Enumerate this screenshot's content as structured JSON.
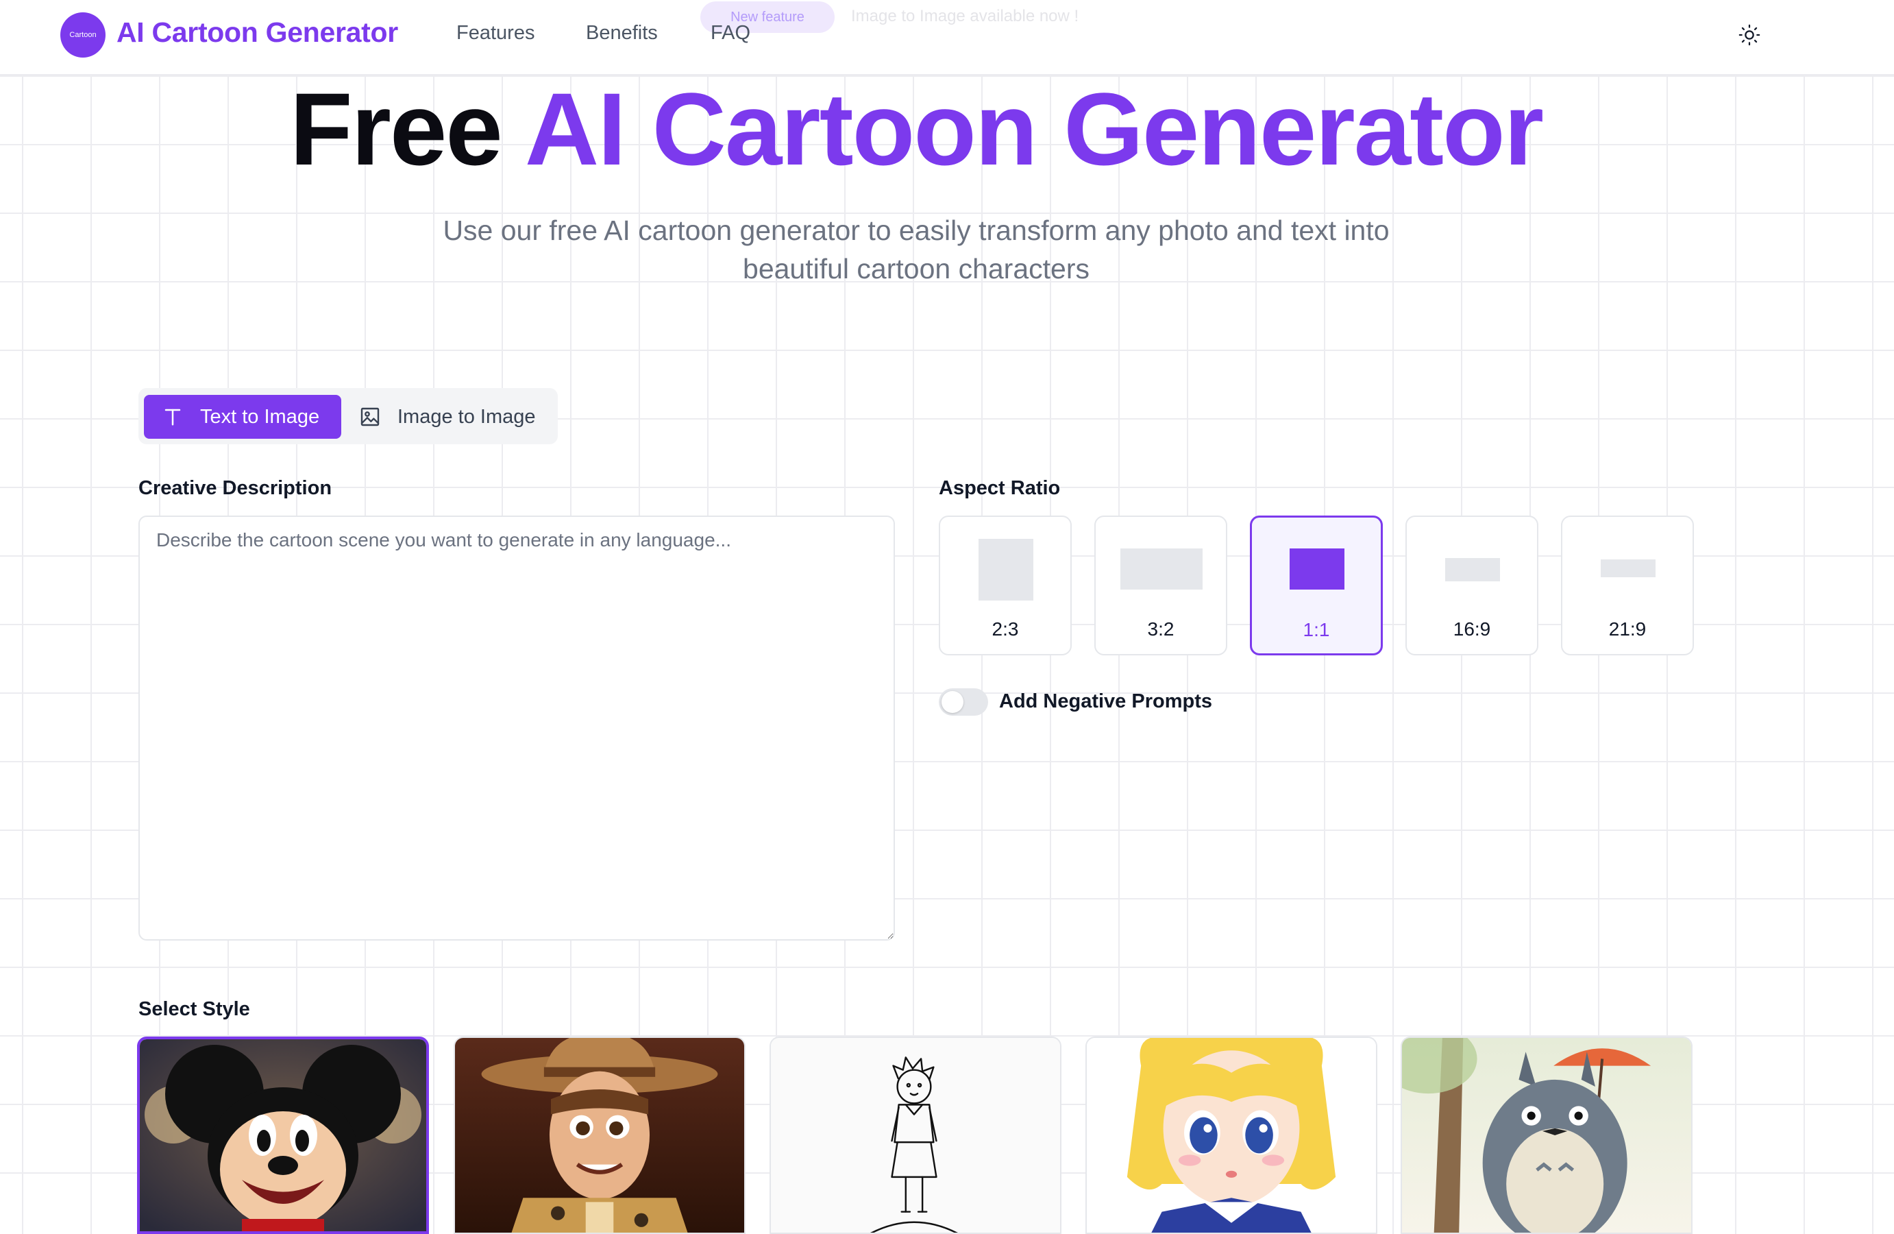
{
  "header": {
    "logo_badge_text": "Cartoon",
    "brand": "AI Cartoon Generator",
    "nav": [
      "Features",
      "Benefits",
      "FAQ"
    ],
    "announcement_badge": "New feature",
    "announcement_text": "Image to Image available now !"
  },
  "hero": {
    "title_plain": "Free",
    "title_accent": "AI Cartoon Generator",
    "subtitle_line1": "Use our free AI cartoon generator to easily transform any photo and text into",
    "subtitle_line2": "beautiful cartoon characters"
  },
  "mode_tabs": [
    {
      "label": "Text to Image",
      "icon": "text-icon",
      "active": true
    },
    {
      "label": "Image to Image",
      "icon": "image-icon",
      "active": false
    }
  ],
  "description": {
    "label": "Creative Description",
    "placeholder": "Describe the cartoon scene you want to generate in any language...",
    "value": ""
  },
  "aspect_ratio": {
    "label": "Aspect Ratio",
    "options": [
      "2:3",
      "3:2",
      "1:1",
      "16:9",
      "21:9"
    ],
    "selected": "1:1"
  },
  "negative_prompts": {
    "label": "Add Negative Prompts",
    "enabled": false
  },
  "styles": {
    "label": "Select Style",
    "items": [
      {
        "icon": "mouse-character-icon",
        "selected": true
      },
      {
        "icon": "cowboy-character-icon",
        "selected": false
      },
      {
        "icon": "line-art-character-icon",
        "selected": false
      },
      {
        "icon": "anime-girl-icon",
        "selected": false
      },
      {
        "icon": "forest-spirit-icon",
        "selected": false
      }
    ]
  },
  "colors": {
    "accent": "#7c3aed",
    "text": "#111827",
    "muted": "#6b7280",
    "border": "#e5e7eb"
  }
}
